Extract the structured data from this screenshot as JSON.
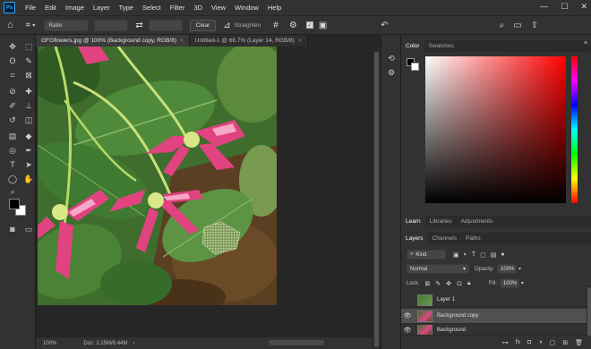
{
  "app": {
    "logo": "Ps"
  },
  "menu": [
    "File",
    "Edit",
    "Image",
    "Layer",
    "Type",
    "Select",
    "Filter",
    "3D",
    "View",
    "Window",
    "Help"
  ],
  "window_controls": {
    "minimize": "—",
    "maximize": "☐",
    "close": "✕"
  },
  "options_bar": {
    "ratio": "Ratio",
    "swap": "⇄",
    "clear": "Clear",
    "straighten": "Straighten",
    "grid": "#",
    "gear": "⚙",
    "check": "✓",
    "undo": "↶",
    "search": "⌕",
    "workspace": "▭",
    "share": "⇪"
  },
  "toolbar_icons": [
    "move-icon",
    "marquee-icon",
    "lasso-icon",
    "quick-select-icon",
    "crop-icon",
    "frame-icon",
    "eyedropper-icon",
    "healing-icon",
    "brush-icon",
    "stamp-icon",
    "history-brush-icon",
    "eraser-icon",
    "gradient-icon",
    "blur-icon",
    "dodge-icon",
    "pen-icon",
    "type-icon",
    "path-select-icon",
    "shape-icon",
    "hand-icon",
    "zoom-icon",
    "quick-mask-icon",
    "screen-mode-icon"
  ],
  "toolbar_glyphs": [
    "✥",
    "⬚",
    "ʘ",
    "✎",
    "⌗",
    "⊠",
    "⊘",
    "✚",
    "✐",
    "⊥",
    "↺",
    "◫",
    "▤",
    "◆",
    "◎",
    "✒",
    "T",
    "➤",
    "◯",
    "✋",
    "⌕",
    "◙",
    "▭"
  ],
  "tabs": [
    {
      "title": "GFGflowers.jpg @ 100% (Background copy, RGB/8)",
      "close": "×"
    },
    {
      "title": "Untitled-1 @ 66.7% (Layer 14, RGB/8)",
      "close": "×"
    }
  ],
  "status": {
    "zoom": "100%",
    "doc": "Doc: 2.15M/6.44M",
    "arrow": "›"
  },
  "color_panel": {
    "tabs": [
      "Color",
      "Swatches"
    ],
    "menu": "≡",
    "foreground": "#000000",
    "background": "#ffffff",
    "hue_color": "#ff0000"
  },
  "learn_panel": {
    "tabs": [
      "Learn",
      "Libraries",
      "Adjustments"
    ]
  },
  "layers_panel": {
    "tabs": [
      "Layers",
      "Channels",
      "Paths"
    ],
    "kind": "Kind",
    "blend_mode": "Normal",
    "opacity_label": "Opacity:",
    "opacity": "100%",
    "lock_label": "Lock:",
    "fill_label": "Fill:",
    "fill": "100%",
    "layers": [
      {
        "name": "Layer 1",
        "visible": "",
        "selected": false
      },
      {
        "name": "Background copy",
        "visible": "👁",
        "selected": true
      },
      {
        "name": "Background",
        "visible": "👁",
        "selected": false
      }
    ],
    "footer_icons": [
      "⊶",
      "fx",
      "◘",
      "◑",
      "▢",
      "⊞",
      "🗑"
    ]
  }
}
